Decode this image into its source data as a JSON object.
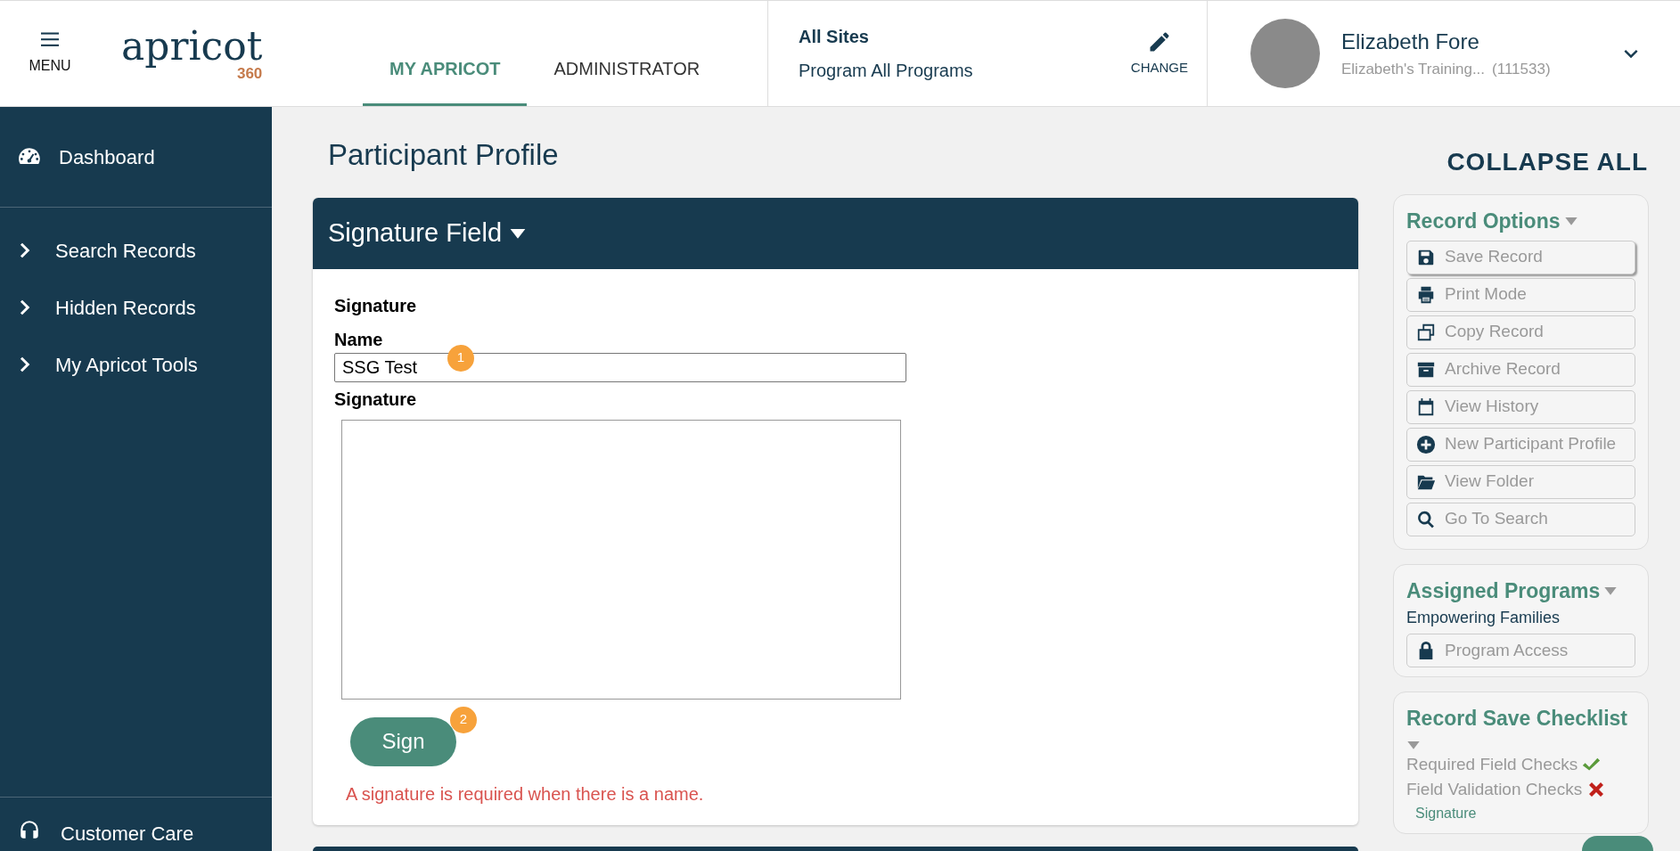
{
  "header": {
    "menu_label": "MENU",
    "logo": {
      "word": "apricot",
      "number": "360"
    },
    "tabs": [
      {
        "label": "MY APRICOT",
        "selected": true
      },
      {
        "label": "ADMINISTRATOR",
        "selected": false
      }
    ],
    "sites": {
      "title": "All Sites",
      "program": "Program All Programs",
      "change_label": "CHANGE"
    },
    "user": {
      "name": "Elizabeth Fore",
      "organization": "Elizabeth's Training...",
      "id": "(111533)"
    }
  },
  "sidebar": {
    "items": [
      {
        "label": "Dashboard",
        "kind": "dashboard"
      },
      {
        "label": "Search Records",
        "kind": "expander"
      },
      {
        "label": "Hidden Records",
        "kind": "expander"
      },
      {
        "label": "My Apricot Tools",
        "kind": "expander"
      }
    ],
    "footer_item": {
      "label": "Customer Care"
    }
  },
  "page_title": "Participant Profile",
  "collapse_all": "COLLAPSE ALL",
  "section": {
    "title": "Signature Field",
    "group_label": "Signature",
    "name_label": "Name",
    "name_value": "SSG Test",
    "name_marker": "1",
    "signature_label": "Signature",
    "sign_button": "Sign",
    "sign_marker": "2",
    "error": "A signature is required when there is a name."
  },
  "record_options": {
    "title": "Record Options",
    "items": [
      {
        "label": "Save Record",
        "kind": "save",
        "highlighted": true
      },
      {
        "label": "Print Mode",
        "kind": "print",
        "highlighted": false
      },
      {
        "label": "Copy Record",
        "kind": "copy",
        "highlighted": false
      },
      {
        "label": "Archive Record",
        "kind": "archive",
        "highlighted": false
      },
      {
        "label": "View History",
        "kind": "calendar",
        "highlighted": false
      },
      {
        "label": "New Participant Profile",
        "kind": "plus",
        "highlighted": false
      },
      {
        "label": "View Folder",
        "kind": "folder",
        "highlighted": false
      },
      {
        "label": "Go To Search",
        "kind": "search",
        "highlighted": false
      }
    ]
  },
  "assigned_programs": {
    "title": "Assigned Programs",
    "program": "Empowering Families",
    "items": [
      {
        "label": "Program Access",
        "kind": "lock",
        "highlighted": false
      }
    ]
  },
  "checklist": {
    "title": "Record Save Checklist",
    "checks": [
      {
        "label": "Required Field Checks",
        "passed": true
      },
      {
        "label": "Field Validation Checks",
        "passed": false
      }
    ],
    "failing_fields": [
      "Signature"
    ]
  }
}
